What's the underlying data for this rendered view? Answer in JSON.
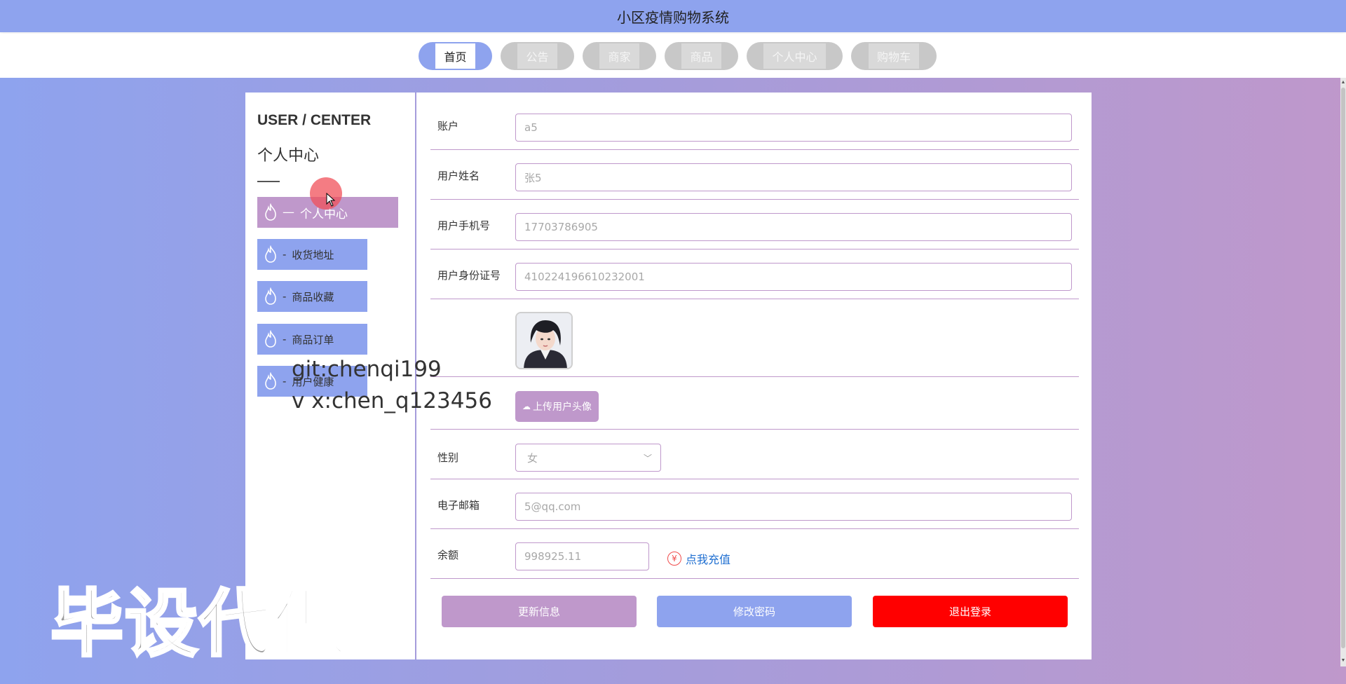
{
  "app": {
    "title": "小区疫情购物系统"
  },
  "nav": {
    "items": [
      {
        "label": "首页",
        "active": true
      },
      {
        "label": "公告",
        "active": false
      },
      {
        "label": "商家",
        "active": false
      },
      {
        "label": "商品",
        "active": false
      },
      {
        "label": "个人中心",
        "active": false
      },
      {
        "label": "购物车",
        "active": false
      }
    ]
  },
  "sidebar": {
    "title_en": "USER / CENTER",
    "title_zh": "个人中心",
    "items": [
      {
        "label": "个人中心",
        "prefix": "—",
        "active": true,
        "icon": "flame-icon"
      },
      {
        "label": "收货地址",
        "prefix": "-",
        "active": false,
        "icon": "flame-icon"
      },
      {
        "label": "商品收藏",
        "prefix": "-",
        "active": false,
        "icon": "flame-icon"
      },
      {
        "label": "商品订单",
        "prefix": "-",
        "active": false,
        "icon": "flame-icon"
      },
      {
        "label": "用户健康",
        "prefix": "-",
        "active": false,
        "icon": "flame-icon"
      }
    ]
  },
  "form": {
    "account": {
      "label": "账户",
      "value": "a5"
    },
    "name": {
      "label": "用户姓名",
      "value": "张5"
    },
    "phone": {
      "label": "用户手机号",
      "value": "17703786905"
    },
    "id_card": {
      "label": "用户身份证号",
      "value": "410224196610232001"
    },
    "avatar": {
      "icon": "user-avatar-photo"
    },
    "upload": {
      "label": "上传用户头像",
      "icon": "cloud-upload-icon"
    },
    "gender": {
      "label": "性别",
      "value": "女"
    },
    "email": {
      "label": "电子邮箱",
      "value": "5@qq.com"
    },
    "balance": {
      "label": "余额",
      "value": "998925.11",
      "recharge_label": "点我充值",
      "recharge_symbol": "¥"
    }
  },
  "actions": {
    "update": {
      "label": "更新信息",
      "color": "#bf98cb"
    },
    "change_password": {
      "label": "修改密码",
      "color": "#8ea3ee"
    },
    "logout": {
      "label": "退出登录",
      "color": "#ff0000"
    }
  },
  "watermark": {
    "git": "git:chenqi199",
    "wx": "v x:chen_q123456",
    "big": "毕设代做"
  },
  "colors": {
    "primary": "#8ea3ee",
    "accent": "#bf98cb",
    "danger": "#ff0000"
  }
}
